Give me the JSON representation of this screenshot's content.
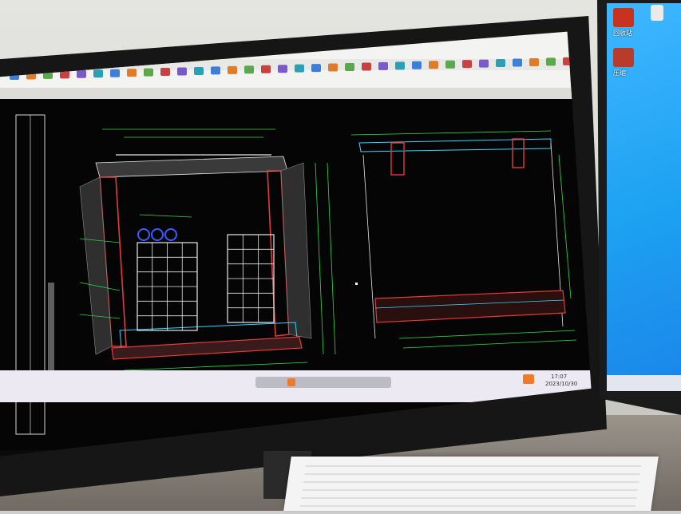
{
  "scene": {
    "description": "",
    "cad_app": {
      "toolbar_rows": 3
    },
    "right_desktop": {
      "icons": [
        {
          "label": "回收站",
          "icon": "recycle-bin-icon",
          "color": "#c7331f"
        },
        {
          "label": "压缩",
          "icon": "archive-icon",
          "color": "#b93b2b"
        },
        {
          "label": "",
          "icon": "document-icon",
          "color": "#eaeaea"
        }
      ]
    },
    "bottom_taskbar": {
      "time": "17:07",
      "date": "2023/10/30"
    },
    "colors": {
      "drawing_green": "#2be04a",
      "drawing_red": "#e53a3a",
      "drawing_cyan": "#35d6ff",
      "drawing_white": "#e8e8e8",
      "desktop_blue": "#1da1f2"
    }
  }
}
